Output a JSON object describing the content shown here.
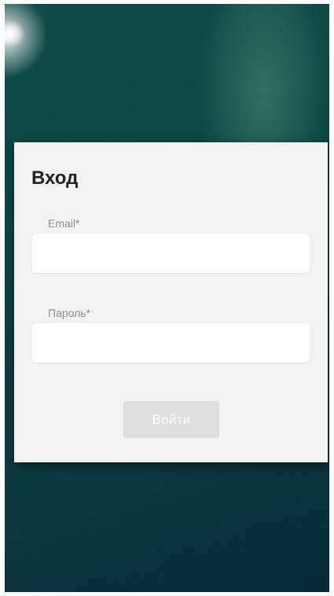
{
  "login": {
    "title": "Вход",
    "email": {
      "label": "Email*",
      "value": "",
      "placeholder": ""
    },
    "password": {
      "label": "Пароль*",
      "value": "",
      "placeholder": ""
    },
    "submit_label": "Войти",
    "submit_disabled": true
  },
  "colors": {
    "background": "#0b4a45",
    "card": "#f3f3f3",
    "input": "#ffffff",
    "button_disabled": "#dedede",
    "title_text": "#222222",
    "label_text": "#8c8c8c"
  }
}
